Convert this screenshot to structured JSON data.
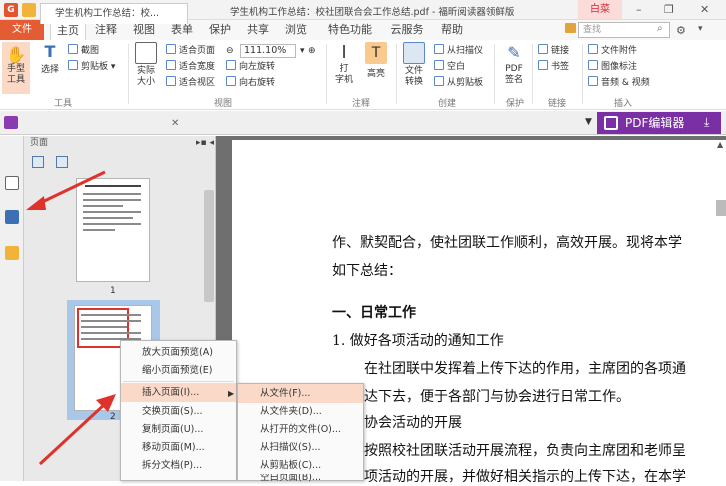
{
  "window": {
    "title": "学生机构工作总结：校社团联合会工作总结.pdf - 福昕阅读器领鲜版",
    "login_label": "白菜",
    "controls": [
      "–",
      "❐",
      "✕"
    ]
  },
  "ribbon_tabs": {
    "file": "文件",
    "tabs": [
      "主页",
      "注释",
      "视图",
      "表单",
      "保护",
      "共享",
      "浏览",
      "特色功能",
      "云服务",
      "帮助"
    ],
    "active": "主页",
    "search_placeholder": "查找"
  },
  "ribbon": {
    "tools_group": {
      "label": "工具",
      "hand": "手型\n工具",
      "select": "选择",
      "screenshot": "截图",
      "clipboard": "剪贴板"
    },
    "view_group": {
      "label": "视图",
      "actual_size": "实际\n大小",
      "fit_page": "适合页面",
      "fit_width": "适合宽度",
      "fit_visible": "适合视区",
      "zoom": "111.10%",
      "rotate_left": "向左旋转",
      "rotate_right": "向右旋转"
    },
    "comment_group": {
      "label": "注释",
      "typewriter": "打\n字机",
      "highlight": "高亮"
    },
    "create_group": {
      "label": "创建",
      "convert": "文件\n转换",
      "from_scanner": "从扫描仪",
      "blank": "空白",
      "from_clipboard": "从剪贴板"
    },
    "protect_group": {
      "label": "保护",
      "pdf_sign": "PDF\n签名"
    },
    "link_group": {
      "label": "链接",
      "link": "链接",
      "bookmark": "书签"
    },
    "insert_group": {
      "label": "插入",
      "attachment": "文件附件",
      "image_annot": "图像标注",
      "audio_video": "音频 & 视频"
    }
  },
  "pdf_editor_button": "PDF编辑器",
  "doc_tab": {
    "title": "学生机构工作总结：校..."
  },
  "pages_panel": {
    "title": "页面",
    "page_numbers": [
      "1",
      "2"
    ]
  },
  "document": {
    "lines": [
      "作、默契配合，使社团联工作顺利，高效开展。现将本学",
      "如下总结：",
      "一、日常工作",
      "1. 做好各项活动的通知工作",
      "在社团联中发挥着上传下达的作用，主席团的各项通",
      "达下去，便于各部门与协会进行日常工作。",
      "协会活动的开展",
      "按照校社团联活动开展流程，负责向主席团和老师呈",
      "项活动的开展，并做好相关指示的上传下达，在本学"
    ]
  },
  "context_menu": {
    "items": [
      "放大页面预览(A)",
      "缩小页面预览(E)",
      "插入页面(I)...",
      "交换页面(S)...",
      "复制页面(U)...",
      "移动页面(M)...",
      "拆分文档(P)..."
    ],
    "highlighted": "插入页面(I)..."
  },
  "submenu": {
    "items": [
      "从文件(F)...",
      "从文件夹(D)...",
      "从打开的文件(O)...",
      "从扫描仪(S)...",
      "从剪贴板(C)...",
      "空白页面(B)..."
    ],
    "highlighted": "从文件(F)..."
  },
  "colors": {
    "accent_orange": "#e45c33",
    "pdf_editor_purple": "#7b2fa4",
    "annotation_red": "#e0322c",
    "menu_highlight": "#fbd9c9"
  }
}
